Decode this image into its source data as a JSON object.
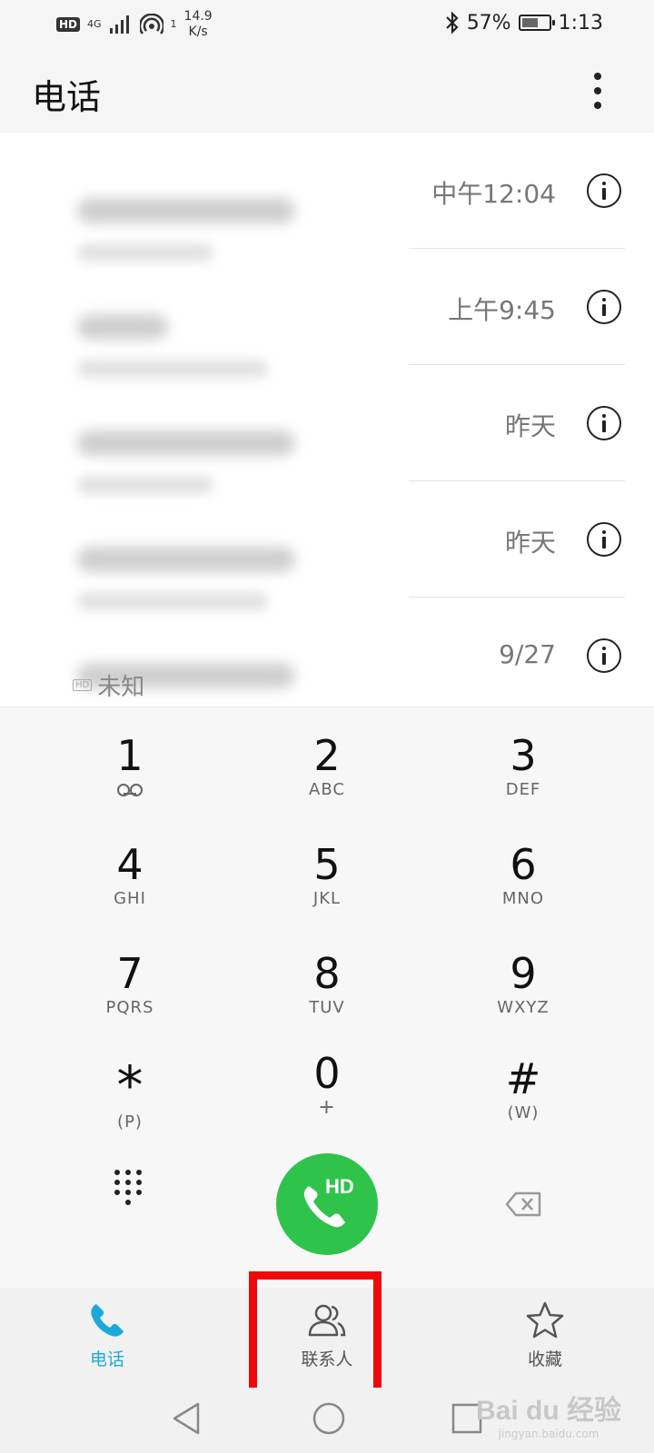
{
  "status_bar": {
    "hd": "HD",
    "network": "4G",
    "wifi_count": "1",
    "speed_value": "14.9",
    "speed_unit": "K/s",
    "battery": "57%",
    "time": "1:13"
  },
  "app_bar": {
    "title": "电话"
  },
  "call_log": [
    {
      "time": "中午12:04"
    },
    {
      "time": "上午9:45"
    },
    {
      "time": "昨天"
    },
    {
      "time": "昨天"
    },
    {
      "time": "9/27"
    }
  ],
  "partial_label": "未知",
  "dialpad": {
    "keys": [
      {
        "digit": "1",
        "sub": ""
      },
      {
        "digit": "2",
        "sub": "ABC"
      },
      {
        "digit": "3",
        "sub": "DEF"
      },
      {
        "digit": "4",
        "sub": "GHI"
      },
      {
        "digit": "5",
        "sub": "JKL"
      },
      {
        "digit": "6",
        "sub": "MNO"
      },
      {
        "digit": "7",
        "sub": "PQRS"
      },
      {
        "digit": "8",
        "sub": "TUV"
      },
      {
        "digit": "9",
        "sub": "WXYZ"
      },
      {
        "digit": "*",
        "sub": "(P)"
      },
      {
        "digit": "0",
        "sub": "+"
      },
      {
        "digit": "#",
        "sub": "(W)"
      }
    ],
    "call_label": "HD"
  },
  "bottom_nav": {
    "phone": "电话",
    "contacts": "联系人",
    "favorites": "收藏"
  },
  "watermark": {
    "main": "Bai du 经验",
    "sub": "jingyan.baidu.com"
  },
  "colors": {
    "accent": "#1aaad8",
    "call_green": "#2fc34c",
    "highlight_red": "#ee0a0a"
  }
}
